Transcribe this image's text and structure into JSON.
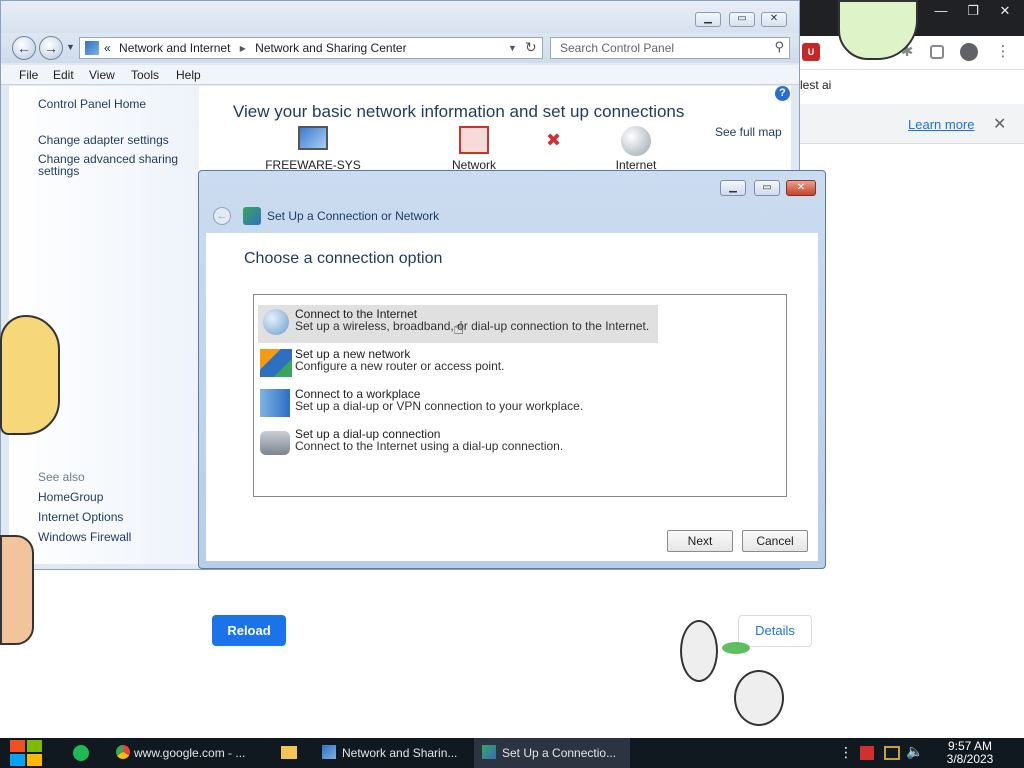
{
  "chrome": {
    "page_text": "lest ai",
    "infobar_link": "Learn more",
    "reload_button": "Reload",
    "details_button": "Details"
  },
  "control_panel": {
    "breadcrumb": [
      "Network and Internet",
      "Network and Sharing Center"
    ],
    "breadcrumb_prefix": "«",
    "search_placeholder": "Search Control Panel",
    "menu": [
      "File",
      "Edit",
      "View",
      "Tools",
      "Help"
    ],
    "left_links": [
      "Control Panel Home",
      "Change adapter settings",
      "Change advanced sharing settings"
    ],
    "see_also_label": "See also",
    "see_also_links": [
      "HomeGroup",
      "Internet Options",
      "Windows Firewall"
    ],
    "heading": "View your basic network information and set up connections",
    "see_full_map": "See full map",
    "network_nodes": [
      "FREEWARE-SYS",
      "Network",
      "Internet"
    ]
  },
  "dialog": {
    "title": "Set Up a Connection or Network",
    "heading": "Choose a connection option",
    "options": [
      {
        "title": "Connect to the Internet",
        "desc": "Set up a wireless, broadband, or dial-up connection to the Internet.",
        "icon": "globe-icon"
      },
      {
        "title": "Set up a new network",
        "desc": "Configure a new router or access point.",
        "icon": "router-icon"
      },
      {
        "title": "Connect to a workplace",
        "desc": "Set up a dial-up or VPN connection to your workplace.",
        "icon": "workplace-icon"
      },
      {
        "title": "Set up a dial-up connection",
        "desc": "Connect to the Internet using a dial-up connection.",
        "icon": "phone-icon"
      }
    ],
    "next_button": "Next",
    "cancel_button": "Cancel"
  },
  "taskbar": {
    "items": [
      "www.google.com - ...",
      "Network and Sharin...",
      "Set Up a Connectio..."
    ],
    "time": "9:57 AM",
    "date": "3/8/2023"
  },
  "colors": {
    "accent": "#1a73e8",
    "selected_option": "#e0e0e0",
    "taskbar": "#101820"
  }
}
